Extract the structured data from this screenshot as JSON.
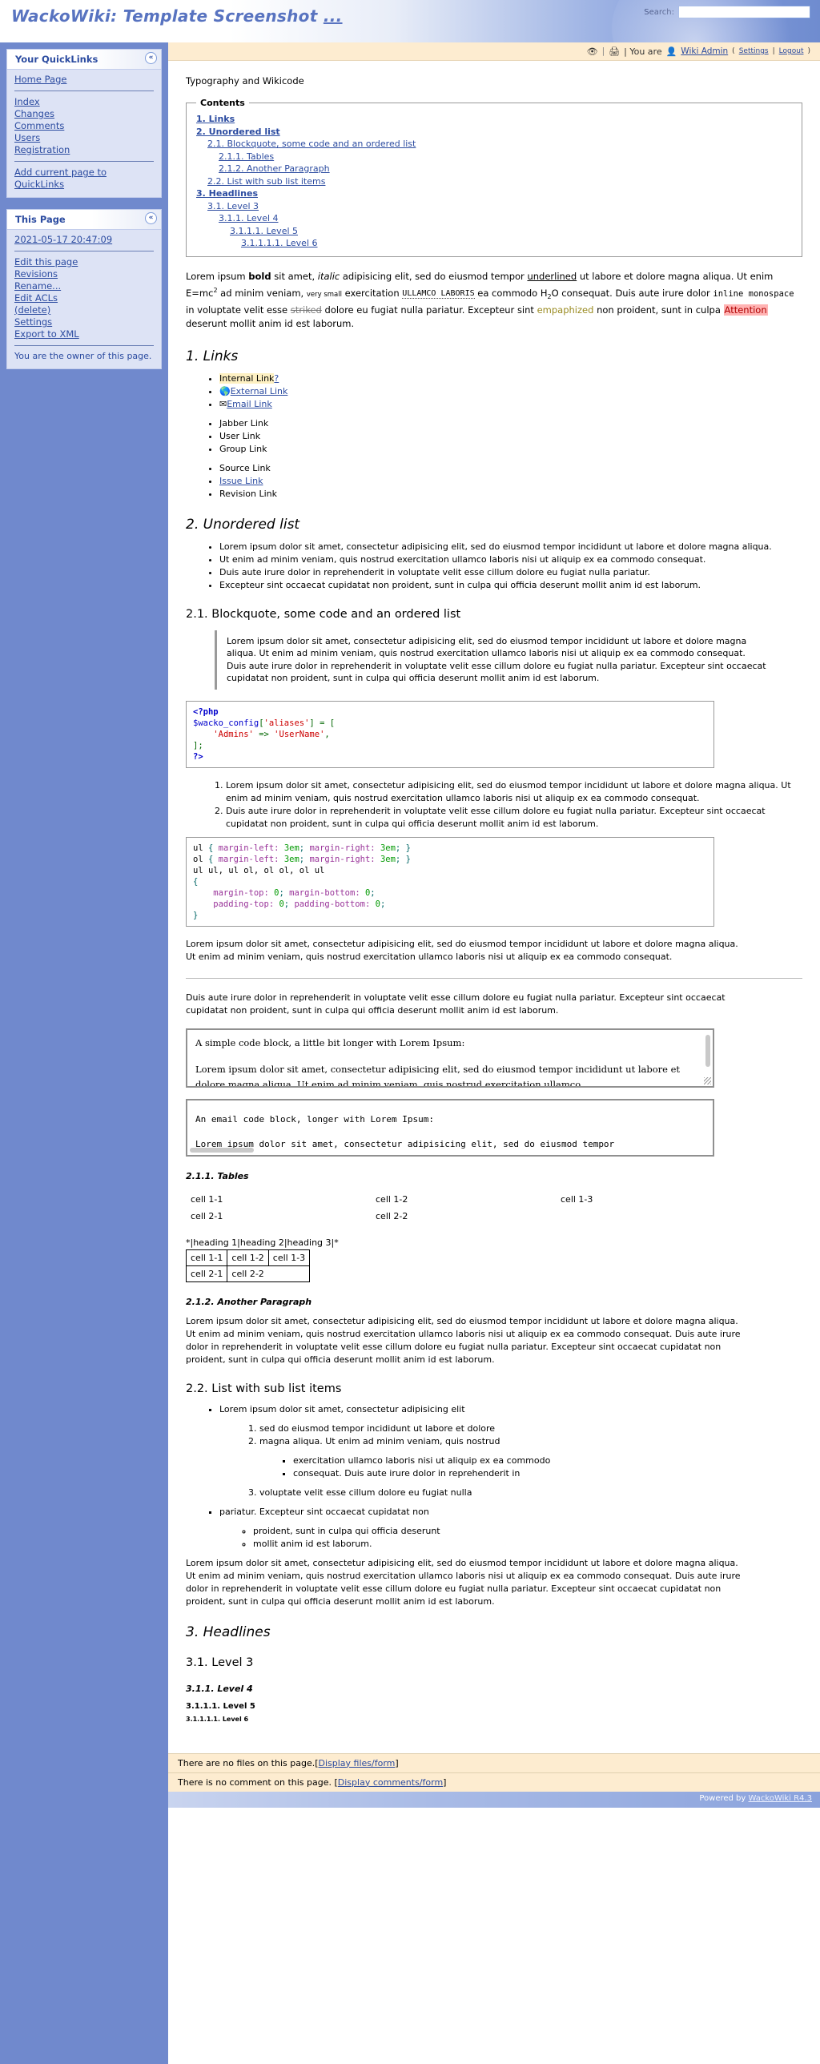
{
  "header": {
    "title": "WackoWiki: Template Screenshot",
    "title_dots": "...",
    "search_label": "Search:",
    "search_value": "",
    "search_placeholder": ""
  },
  "toolbar": {
    "print_icon": "printer-icon",
    "watch_icon": "watch-icon",
    "you_are": "| You are",
    "user_icon": "user-icon",
    "user_name": "Wiki Admin",
    "paren_open": "(",
    "settings": "Settings",
    "pipe": "|",
    "logout": "Logout",
    "paren_close": ")",
    "sep1": "|",
    "sep2": "|"
  },
  "sidebar": {
    "quicklinks": {
      "title": "Your QuickLinks",
      "collapse": "«",
      "home": "Home Page",
      "links": [
        "Index",
        "Changes",
        "Comments",
        "Users",
        "Registration"
      ],
      "add": "Add current page to QuickLinks"
    },
    "thispage": {
      "title": "This Page",
      "collapse": "«",
      "timestamp": "2021-05-17 20:47:09",
      "actions": [
        "Edit this page",
        "Revisions",
        "Rename...",
        "Edit ACLs",
        "(delete)",
        "Settings",
        "Export to XML"
      ],
      "owner_note": "You are the owner of this page."
    }
  },
  "main": {
    "intro": "Typography and Wikicode",
    "toc": {
      "legend": "Contents",
      "items": [
        {
          "label": "1. Links",
          "level": 1
        },
        {
          "label": "2. Unordered list",
          "level": 1
        },
        {
          "label": "2.1. Blockquote, some code and an ordered list",
          "level": 2
        },
        {
          "label": "2.1.1. Tables",
          "level": 3
        },
        {
          "label": "2.1.2. Another Paragraph",
          "level": 3
        },
        {
          "label": "2.2. List with sub list items",
          "level": 2
        },
        {
          "label": "3. Headlines",
          "level": 1
        },
        {
          "label": "3.1. Level 3",
          "level": 2
        },
        {
          "label": "3.1.1. Level 4",
          "level": 3
        },
        {
          "label": "3.1.1.1. Level 5",
          "level": 4
        },
        {
          "label": "3.1.1.1.1. Level 6",
          "level": 5
        }
      ]
    },
    "typography": {
      "t1": "Lorem ipsum ",
      "bold": "bold",
      "t2": " sit amet, ",
      "italic": "italic",
      "t3": " adipisicing elit, sed do eiusmod tempor ",
      "underlined": "underlined",
      "t4": " ut labore et dolore magna aliqua. Ut enim E=mc",
      "sup": "2",
      "t5": " ad minim veniam, ",
      "verysmall": "very small",
      "t6": " exercitation ",
      "dotted": "ULLAMCO LABORIS",
      "t7": " ea commodo H",
      "sub": "2",
      "t8": "O consequat. Duis aute irure dolor ",
      "mono": "inline monospace",
      "t9": " in voluptate velit esse ",
      "striked": "striked",
      "t10": " dolore eu fugiat nulla pariatur. Excepteur sint ",
      "emphasized": "empaphized",
      "t11": " non proident, sunt in culpa ",
      "attention": "Attention",
      "t12": " deserunt mollit anim id est laborum."
    },
    "links_section": {
      "heading": "1. Links",
      "group1": [
        {
          "label": "Internal Link",
          "suffix": "?",
          "style": "internal"
        },
        {
          "label": "External Link",
          "icon": "globe-icon",
          "style": "external"
        },
        {
          "label": "Email Link",
          "icon": "envelope-icon",
          "style": "email"
        }
      ],
      "group2": [
        "Jabber Link",
        "User Link",
        "Group Link"
      ],
      "group3": [
        {
          "label": "Source Link",
          "link": false
        },
        {
          "label": "Issue Link",
          "link": true
        },
        {
          "label": "Revision Link",
          "link": false
        }
      ]
    },
    "unordered_section": {
      "heading": "2. Unordered list",
      "items": [
        "Lorem ipsum dolor sit amet, consectetur adipisicing elit, sed do eiusmod tempor incididunt ut labore et dolore magna aliqua.",
        "Ut enim ad minim veniam, quis nostrud exercitation ullamco laboris nisi ut aliquip ex ea commodo consequat.",
        "Duis aute irure dolor in reprehenderit in voluptate velit esse cillum dolore eu fugiat nulla pariatur.",
        "Excepteur sint occaecat cupidatat non proident, sunt in culpa qui officia deserunt mollit anim id est laborum."
      ]
    },
    "blockquote_section": {
      "heading": "2.1. Blockquote, some code and an ordered list",
      "quote_p1": "Lorem ipsum dolor sit amet, consectetur adipisicing elit, sed do eiusmod tempor incididunt ut labore et dolore magna aliqua. Ut enim ad minim veniam, quis nostrud exercitation ullamco laboris nisi ut aliquip ex ea commodo consequat.",
      "quote_p2": "Duis aute irure dolor in reprehenderit in voluptate velit esse cillum dolore eu fugiat nulla pariatur. Excepteur sint occaecat cupidatat non proident, sunt in culpa qui officia deserunt mollit anim id est laborum."
    },
    "php_code": {
      "l1": "<?php",
      "l2_var": "$wacko_config",
      "l2_b1": "[",
      "l2_str": "'aliases'",
      "l2_b2": "]",
      "l2_eq": " = ",
      "l2_b3": "[",
      "l3_key": "'Admins'",
      "l3_arrow": " => ",
      "l3_val": "'UserName'",
      "l3_comma": ",",
      "l4": "];",
      "l5": "?>"
    },
    "ordered_list": [
      "Lorem ipsum dolor sit amet, consectetur adipisicing elit, sed do eiusmod tempor incididunt ut labore et dolore magna aliqua. Ut enim ad minim veniam, quis nostrud exercitation ullamco laboris nisi ut aliquip ex ea commodo consequat.",
      "Duis aute irure dolor in reprehenderit in voluptate velit esse cillum dolore eu fugiat nulla pariatur. Excepteur sint occaecat cupidatat non proident, sunt in culpa qui officia deserunt mollit anim id est laborum."
    ],
    "css_code": {
      "l1_sel": "ul ",
      "l1_brace_o": "{",
      "l1_prop1": " margin-left: ",
      "l1_val1": "3em",
      "l1_semi1": "; ",
      "l1_prop2": "margin-right: ",
      "l1_val2": "3em",
      "l1_semi2": "; ",
      "l1_brace_c": "}",
      "l2_sel": "ol ",
      "l3": "ul ul, ul ol, ol ol, ol ul",
      "l4": "{",
      "l5_prop1": "    margin-top: ",
      "l5_v1": "0",
      "l5_s1": "; ",
      "l5_prop2": "margin-bottom: ",
      "l5_v2": "0",
      "l5_s2": ";",
      "l6_prop1": "    padding-top: ",
      "l6_v1": "0",
      "l6_s1": "; ",
      "l6_prop2": "padding-bottom: ",
      "l6_v2": "0",
      "l6_s2": ";",
      "l7": "}"
    },
    "para_after_css": "Lorem ipsum dolor sit amet, consectetur adipisicing elit, sed do eiusmod tempor incididunt ut labore et dolore magna aliqua. Ut enim ad minim veniam, quis nostrud exercitation ullamco laboris nisi ut aliquip ex ea commodo consequat.",
    "para_after_rule": "Duis aute irure dolor in reprehenderit in voluptate velit esse cillum dolore eu fugiat nulla pariatur. Excepteur sint occaecat cupidatat non proident, sunt in culpa qui officia deserunt mollit anim id est laborum.",
    "simple_code_block": {
      "line1": "A simple code block, a little bit longer with Lorem Ipsum:",
      "line2": "Lorem ipsum dolor sit amet, consectetur adipisicing elit, sed do eiusmod tempor incididunt ut labore et dolore magna aliqua. Ut enim ad minim veniam, quis nostrud exercitation ullamco"
    },
    "email_code_block": {
      "line1": "An email code block, longer with Lorem Ipsum:",
      "line2": "Lorem ipsum dolor sit amet, consectetur adipisicing elit, sed do eiusmod tempor"
    },
    "tables_section": {
      "heading": "2.1.1. Tables",
      "plain_rows": [
        [
          "cell 1-1",
          "cell 1-2",
          "cell 1-3"
        ],
        [
          "cell 2-1",
          "cell 2-2",
          ""
        ]
      ],
      "source_line": "*|heading 1|heading 2|heading 3|*",
      "bordered_rows": [
        [
          "cell 1-1",
          "cell 1-2",
          "cell 1-3"
        ],
        [
          "cell 2-1",
          "cell 2-2"
        ]
      ]
    },
    "another_paragraph": {
      "heading": "2.1.2. Another Paragraph",
      "text": "Lorem ipsum dolor sit amet, consectetur adipisicing elit, sed do eiusmod tempor incididunt ut labore et dolore magna aliqua. Ut enim ad minim veniam, quis nostrud exercitation ullamco laboris nisi ut aliquip ex ea commodo consequat. Duis aute irure dolor in reprehenderit in voluptate velit esse cillum dolore eu fugiat nulla pariatur. Excepteur sint occaecat cupidatat non proident, sunt in culpa qui officia deserunt mollit anim id est laborum."
    },
    "sublist_section": {
      "heading": "2.2. List with sub list items",
      "item1": "Lorem ipsum dolor sit amet, consectetur adipisicing elit",
      "sub1": "sed do eiusmod tempor incididunt ut labore et dolore",
      "sub2": "magna aliqua. Ut enim ad minim veniam, quis nostrud",
      "subsub1": "exercitation ullamco laboris nisi ut aliquip ex ea commodo",
      "subsub2": "consequat. Duis aute irure dolor in reprehenderit in",
      "sub3": "voluptate velit esse cillum dolore eu fugiat nulla",
      "item2": "pariatur. Excepteur sint occaecat cupidatat non",
      "circ1": "proident, sunt in culpa qui officia deserunt",
      "circ2": "mollit anim id est laborum.",
      "closing": "Lorem ipsum dolor sit amet, consectetur adipisicing elit, sed do eiusmod tempor incididunt ut labore et dolore magna aliqua. Ut enim ad minim veniam, quis nostrud exercitation ullamco laboris nisi ut aliquip ex ea commodo consequat. Duis aute irure dolor in reprehenderit in voluptate velit esse cillum dolore eu fugiat nulla pariatur. Excepteur sint occaecat cupidatat non proident, sunt in culpa qui officia deserunt mollit anim id est laborum."
    },
    "headlines_section": {
      "h2": "3. Headlines",
      "h3": "3.1. Level 3",
      "h4": "3.1.1. Level 4",
      "h5": "3.1.1.1. Level 5",
      "h6": "3.1.1.1.1. Level 6"
    }
  },
  "footer": {
    "files_text": "There are no files on this page.",
    "files_bracket_open": "[",
    "files_link": "Display files/form",
    "files_bracket_close": "]",
    "comments_text": "There is no comment on this page.",
    "comments_bracket_open": "[",
    "comments_link": "Display comments/form",
    "comments_bracket_close": "]",
    "powered_text": "Powered by",
    "powered_link": "WackoWiki R4.3"
  },
  "colors": {
    "accent": "#2b4ba0",
    "sidebar_bg": "#7089cd",
    "panel_bg": "#dde3f5",
    "toolbar_bg": "#fdecd0",
    "attention": "#ffb3b3",
    "emphasized": "#9a8b21"
  }
}
